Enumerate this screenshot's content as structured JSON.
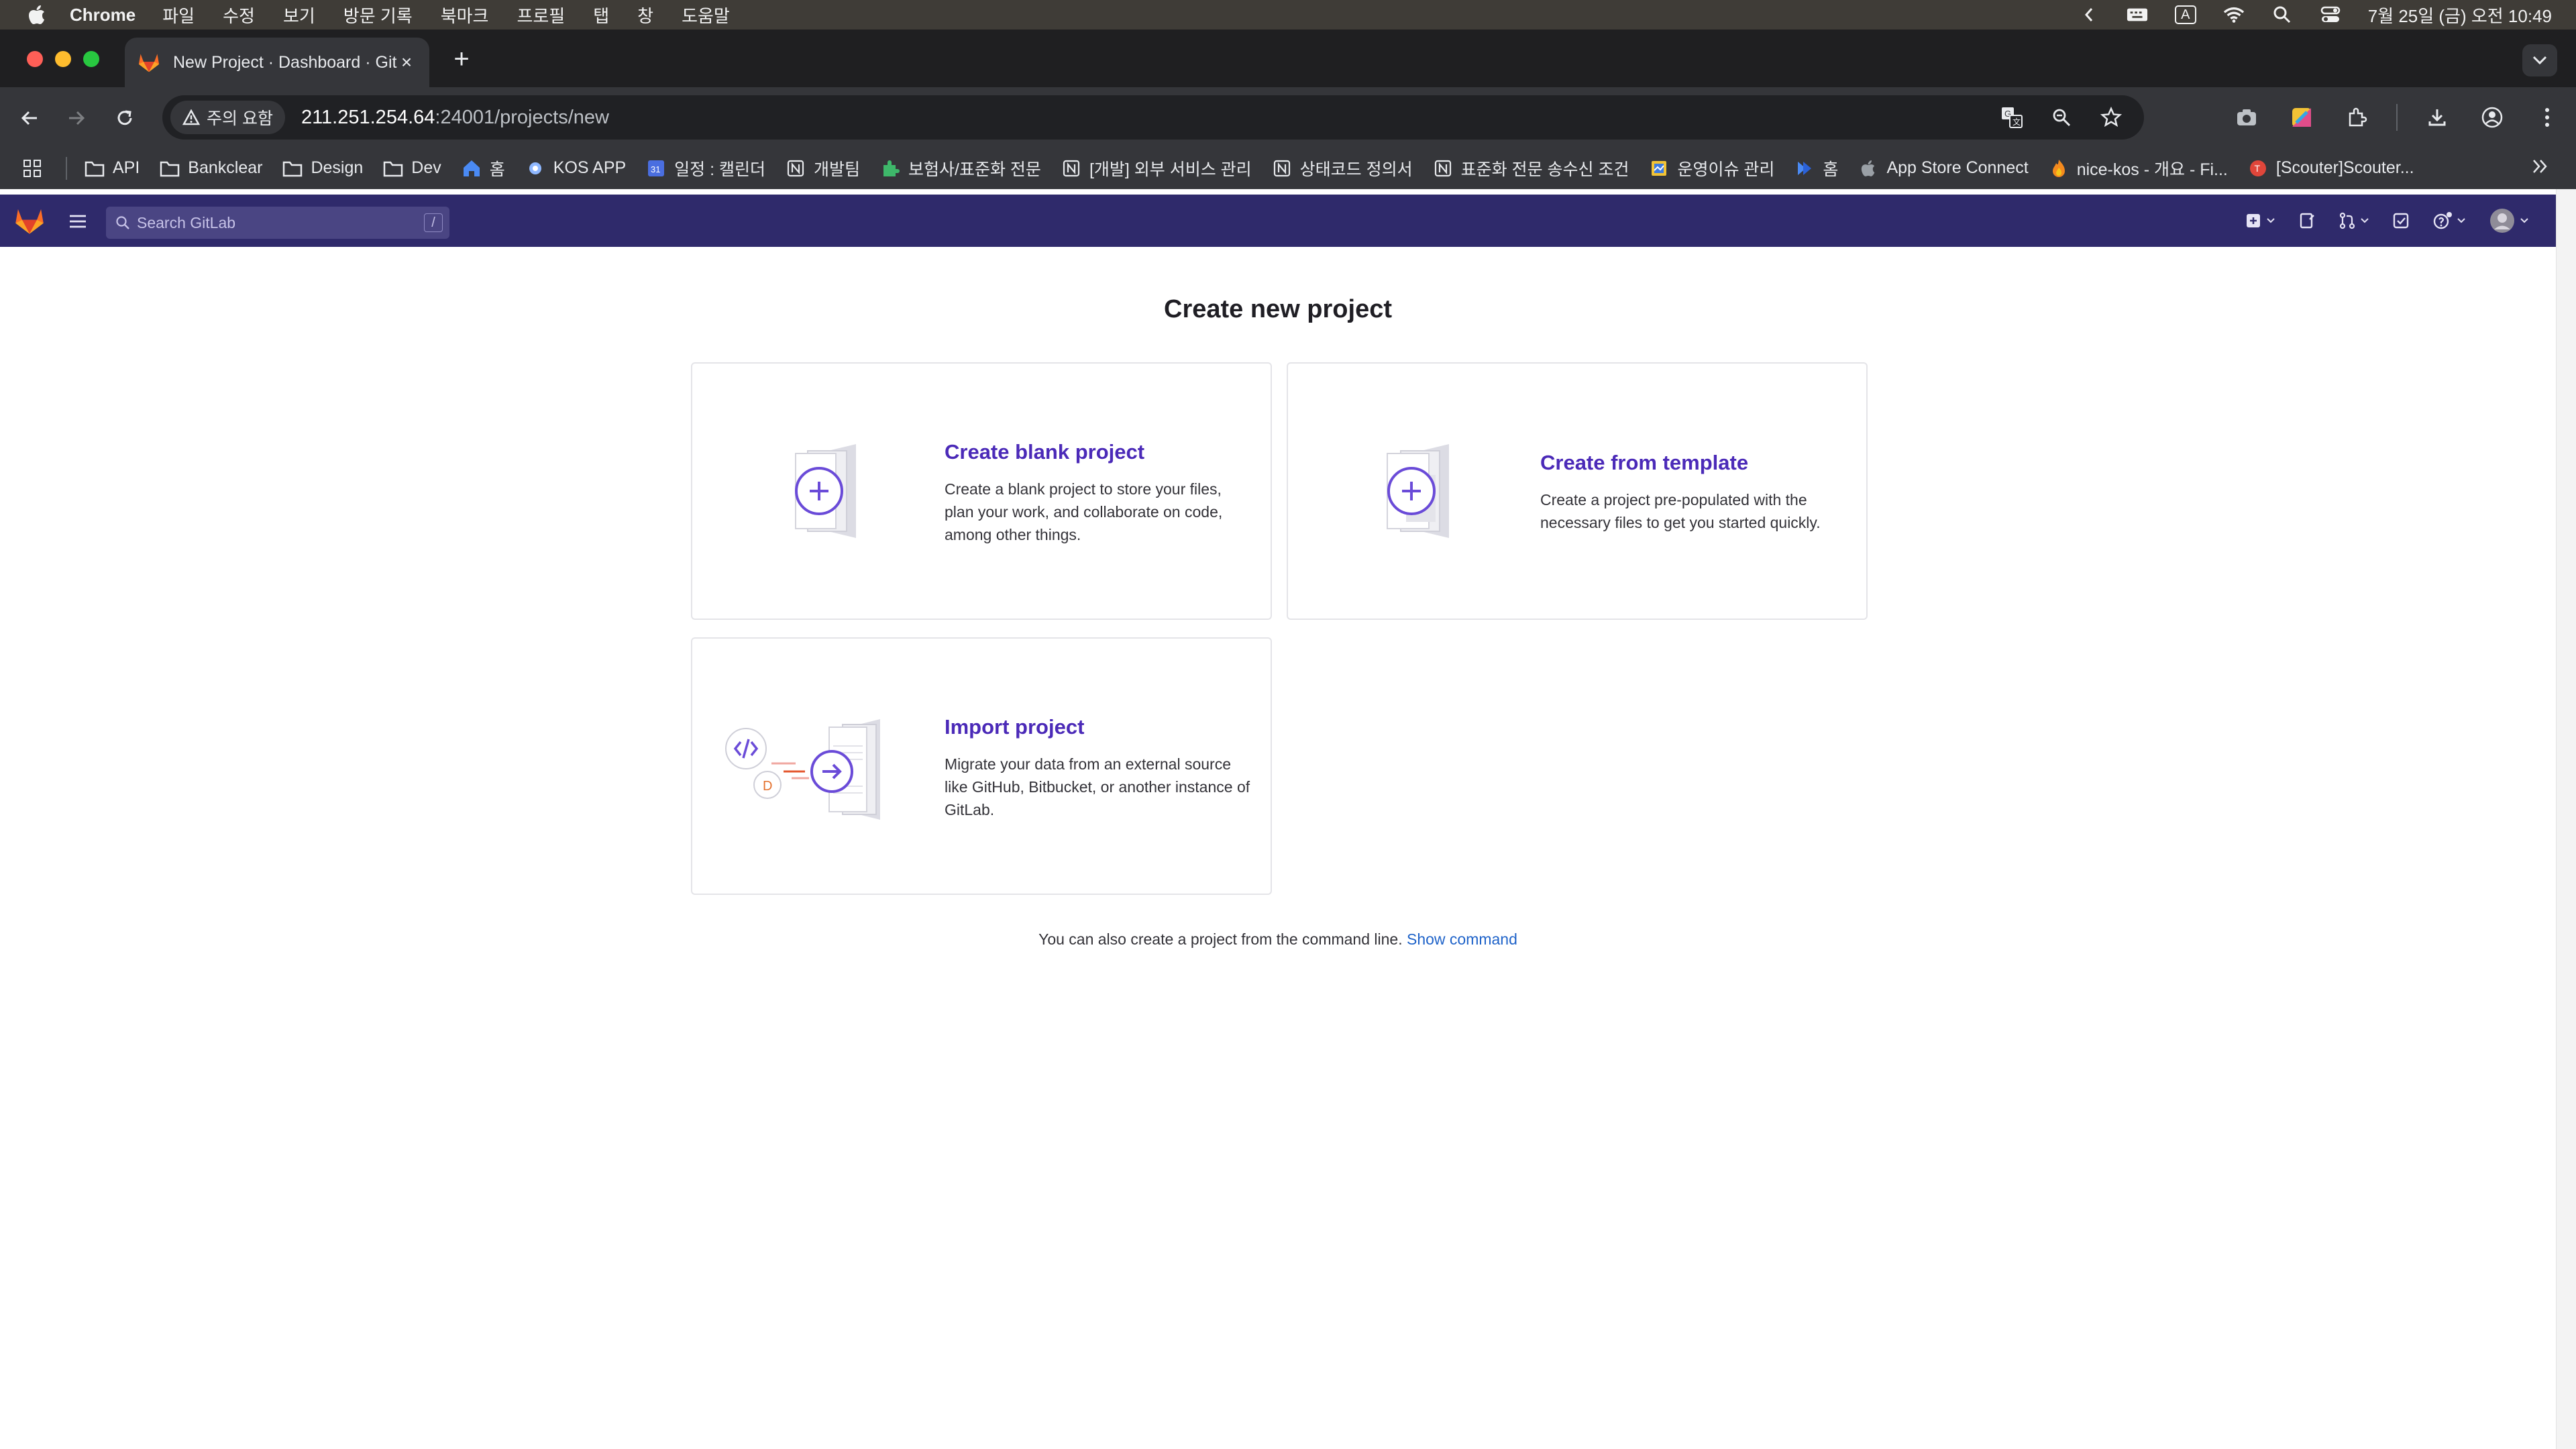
{
  "menubar": {
    "app": "Chrome",
    "items": [
      "파일",
      "수정",
      "보기",
      "방문 기록",
      "북마크",
      "프로필",
      "탭",
      "창",
      "도움말"
    ],
    "clock": "7월 25일 (금) 오전 10:49",
    "input_indicator": "A"
  },
  "browser": {
    "tab_title": "New Project · Dashboard · Git",
    "security_label": "주의 요함",
    "url_host": "211.251.254.64",
    "url_path": ":24001/projects/new"
  },
  "bookmarks": [
    {
      "label": "API",
      "icon": "folder-icon"
    },
    {
      "label": "Bankclear",
      "icon": "folder-icon"
    },
    {
      "label": "Design",
      "icon": "folder-icon"
    },
    {
      "label": "Dev",
      "icon": "folder-icon"
    },
    {
      "label": "홈",
      "icon": "home-icon"
    },
    {
      "label": "KOS APP",
      "icon": "app-icon"
    },
    {
      "label": "일정 : 캘린더",
      "icon": "calendar-icon"
    },
    {
      "label": "개발팀",
      "icon": "notion-icon"
    },
    {
      "label": "보험사/표준화 전문",
      "icon": "puzzle-icon"
    },
    {
      "label": "[개발] 외부 서비스 관리",
      "icon": "notion-icon"
    },
    {
      "label": "상태코드 정의서",
      "icon": "notion-icon"
    },
    {
      "label": "표준화 전문 송수신 조건",
      "icon": "notion-icon"
    },
    {
      "label": "운영이슈 관리",
      "icon": "sheet-icon"
    },
    {
      "label": "홈",
      "icon": "jira-icon"
    },
    {
      "label": "App Store Connect",
      "icon": "apple-icon"
    },
    {
      "label": "nice-kos - 개요 - Fi...",
      "icon": "fire-icon"
    },
    {
      "label": "[Scouter]Scouter...",
      "icon": "scouter-icon"
    }
  ],
  "gitlab": {
    "search_placeholder": "Search GitLab",
    "search_shortcut": "/"
  },
  "page": {
    "title": "Create new project",
    "cards": {
      "blank": {
        "title": "Create blank project",
        "desc": "Create a blank project to store your files, plan your work, and collaborate on code, among other things."
      },
      "template": {
        "title": "Create from template",
        "desc": "Create a project pre-populated with the necessary files to get you started quickly."
      },
      "import": {
        "title": "Import project",
        "desc": "Migrate your data from an external source like GitHub, Bitbucket, or another instance of GitLab."
      }
    },
    "cli_text": "You can also create a project from the command line.",
    "cli_link": "Show command"
  },
  "colors": {
    "gitlab_nav": "#2f2a6b",
    "card_title": "#4b2ab8",
    "link": "#1f63c9"
  }
}
